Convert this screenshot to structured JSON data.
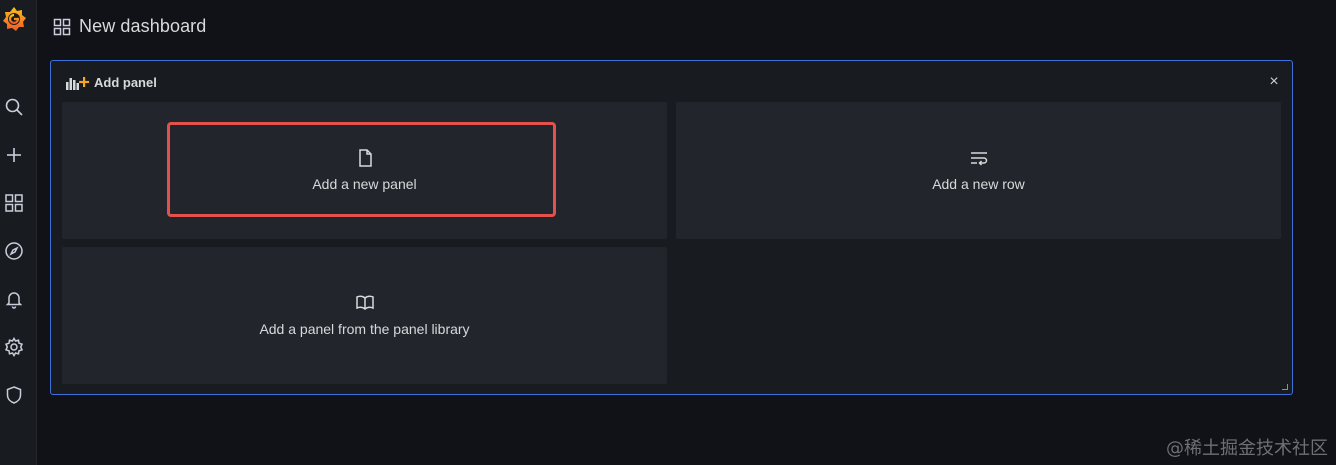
{
  "topbar": {
    "title": "New dashboard"
  },
  "add_panel": {
    "title": "Add panel",
    "close_glyph": "×",
    "tiles": [
      {
        "label": "Add a new panel",
        "icon": "file-icon"
      },
      {
        "label": "Add a new row",
        "icon": "row-icon"
      },
      {
        "label": "Add a panel from the panel library",
        "icon": "book-open-icon"
      }
    ]
  },
  "sidebar": {
    "icons": [
      "grafana-logo",
      "search-icon",
      "plus-icon",
      "dashboards-icon",
      "explore-icon",
      "alerting-icon",
      "configuration-icon",
      "shield-icon"
    ]
  },
  "colors": {
    "background": "#111217",
    "panel": "#181b1f",
    "tile": "#22252b",
    "panel_border": "#3d71d9",
    "highlight": "#e3514a",
    "logo_orange": "#f46800"
  },
  "watermark": "@稀土掘金技术社区"
}
